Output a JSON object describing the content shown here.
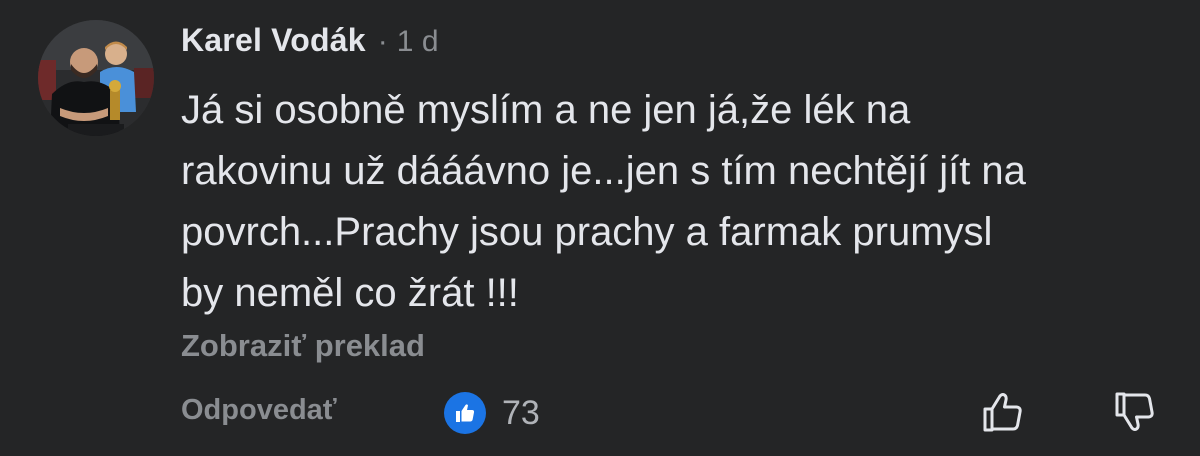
{
  "comment": {
    "author": "Karel Vodák",
    "separator": "·",
    "timestamp": "1 d",
    "text_lines": [
      "Já si osobně myslím a ne jen já,že lék na",
      "rakovinu už dááávno je...jen s tím nechtějí jít na",
      "povrch...Prachy jsou prachy a farmak prumysl",
      "by neměl co žrát !!!"
    ],
    "translate_label": "Zobraziť preklad",
    "reply_label": "Odpovedať",
    "like_count": "73"
  },
  "icons": {
    "reaction": "like-thumb-icon",
    "upvote": "thumbs-up-outline-icon",
    "downvote": "thumbs-down-outline-icon"
  },
  "colors": {
    "background": "#242526",
    "primary_text": "#e4e6eb",
    "secondary_text": "#8a8d91",
    "like_blue": "#1b74e4"
  }
}
